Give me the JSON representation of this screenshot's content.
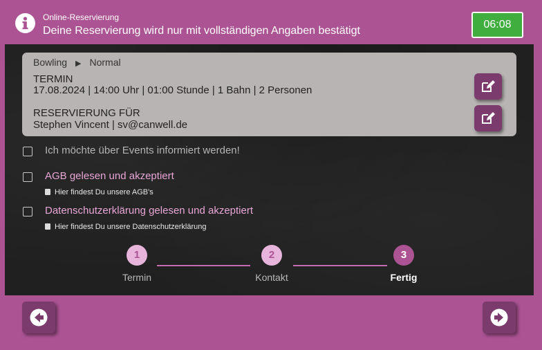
{
  "header": {
    "subtitle": "Online-Reservierung",
    "title": "Deine Reservierung wird nur mit vollständigen Angaben bestätigt",
    "timer": "06:08",
    "timer_color": "#3fae3f"
  },
  "summary": {
    "breadcrumb": [
      "Bowling",
      "Normal"
    ],
    "breadcrumb_separator": "▶",
    "termin_label": "TERMIN",
    "termin_value": "17.08.2024 | 14:00 Uhr | 01:00 Stunde | 1 Bahn | 2 Personen",
    "reservierung_label": "RESERVIERUNG FÜR",
    "reservierung_value": "Stephen Vincent | sv@canwell.de"
  },
  "checkboxes": [
    {
      "label": "Ich möchte über Events informiert werden!",
      "sub": "",
      "checked": false,
      "label_color": "#b4b4b4"
    },
    {
      "label": "AGB gelesen und akzeptiert",
      "sub": "Hier findest Du unsere AGB's",
      "checked": false,
      "label_color": "#e8a6d6"
    },
    {
      "label": "Datenschutzerklärung gelesen und akzeptiert",
      "sub": "Hier findest Du unsere Datenschutzerklärung",
      "checked": false,
      "label_color": "#e8a6d6"
    }
  ],
  "stepper": {
    "steps": [
      {
        "number": "1",
        "label": "Termin"
      },
      {
        "number": "2",
        "label": "Kontakt"
      },
      {
        "number": "3",
        "label": "Fertig"
      }
    ],
    "active_step": 3
  },
  "colors": {
    "brand": "#ac5394",
    "button": "#7b3b6d",
    "step_done": "#e7b4dc",
    "step_active": "#ac5394"
  },
  "icons": {
    "header": "info-circle-icon",
    "edit": "edit-pencil-icon",
    "back": "arrow-left-circle-icon",
    "next": "arrow-right-circle-icon",
    "sub_link": "book-icon"
  }
}
